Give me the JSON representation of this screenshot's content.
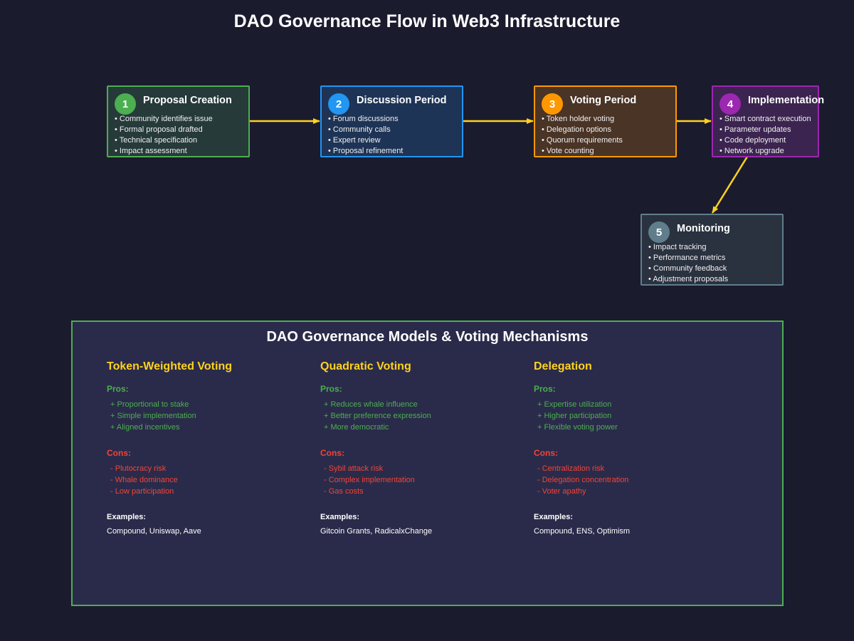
{
  "title": "DAO Governance Flow in Web3 Infrastructure",
  "colors": {
    "background": "#1b1b2e",
    "arrow": "#ffd21f",
    "step1": "#4caf50",
    "step2": "#2196f3",
    "step3": "#ff9800",
    "step4": "#9c27b0",
    "step5": "#607d8b"
  },
  "steps": [
    {
      "number": "1",
      "title": "Proposal Creation",
      "items": [
        "Community identifies issue",
        "Formal proposal drafted",
        "Technical specification",
        "Impact assessment"
      ]
    },
    {
      "number": "2",
      "title": "Discussion Period",
      "items": [
        "Forum discussions",
        "Community calls",
        "Expert review",
        "Proposal refinement"
      ]
    },
    {
      "number": "3",
      "title": "Voting Period",
      "items": [
        "Token holder voting",
        "Delegation options",
        "Quorum requirements",
        "Vote counting"
      ]
    },
    {
      "number": "4",
      "title": "Implementation",
      "items": [
        "Smart contract execution",
        "Parameter updates",
        "Code deployment",
        "Network upgrade"
      ]
    },
    {
      "number": "5",
      "title": "Monitoring",
      "items": [
        "Impact tracking",
        "Performance metrics",
        "Community feedback",
        "Adjustment proposals"
      ]
    }
  ],
  "models_section": {
    "title": "DAO Governance Models & Voting Mechanisms",
    "pros_label": "Pros:",
    "cons_label": "Cons:",
    "examples_label": "Examples:",
    "models": [
      {
        "name": "Token-Weighted Voting",
        "pros": [
          "Proportional to stake",
          "Simple implementation",
          "Aligned incentives"
        ],
        "cons": [
          "Plutocracy risk",
          "Whale dominance",
          "Low participation"
        ],
        "examples": "Compound, Uniswap, Aave"
      },
      {
        "name": "Quadratic Voting",
        "pros": [
          "Reduces whale influence",
          "Better preference expression",
          "More democratic"
        ],
        "cons": [
          "Sybil attack risk",
          "Complex implementation",
          "Gas costs"
        ],
        "examples": "Gitcoin Grants, RadicalxChange"
      },
      {
        "name": "Delegation",
        "pros": [
          "Expertise utilization",
          "Higher participation",
          "Flexible voting power"
        ],
        "cons": [
          "Centralization risk",
          "Delegation concentration",
          "Voter apathy"
        ],
        "examples": "Compound, ENS, Optimism"
      }
    ]
  }
}
